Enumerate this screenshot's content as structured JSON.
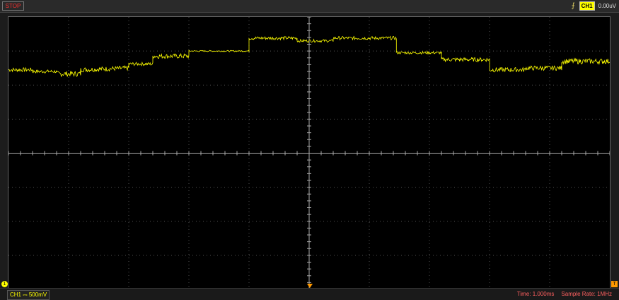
{
  "toolbar": {
    "stop_label": "STOP",
    "trigger_source": "CH1",
    "trigger_level": "0.00uV"
  },
  "markers": {
    "channel_marker": "1",
    "trigger_marker": "T"
  },
  "status": {
    "channel_scale": "CH1 ⎓ 500mV",
    "time": "Time: 1.000ms",
    "sample_rate": "Sample Rate: 1MHz"
  },
  "colors": {
    "trace": "#ffff00",
    "grid": "#3a3a3a",
    "stop": "#ff3030"
  },
  "chart_data": {
    "type": "line",
    "series": [
      {
        "segments": [
          {
            "x": [
              0.0,
              0.04
            ],
            "y": [
              2.45,
              2.45
            ],
            "noise": 0.06
          },
          {
            "x": [
              0.04,
              0.08
            ],
            "y": [
              2.4,
              2.4
            ],
            "noise": 0.05
          },
          {
            "x": [
              0.08,
              0.12
            ],
            "y": [
              2.33,
              2.33
            ],
            "noise": 0.08
          },
          {
            "x": [
              0.12,
              0.2
            ],
            "y": [
              2.45,
              2.5
            ],
            "noise": 0.07
          },
          {
            "x": [
              0.2,
              0.24
            ],
            "y": [
              2.62,
              2.62
            ],
            "noise": 0.05
          },
          {
            "x": [
              0.24,
              0.3
            ],
            "y": [
              2.85,
              2.85
            ],
            "noise": 0.07
          },
          {
            "x": [
              0.3,
              0.4
            ],
            "y": [
              3.0,
              3.0
            ],
            "noise": 0.02
          },
          {
            "x": [
              0.4,
              0.48
            ],
            "y": [
              3.38,
              3.38
            ],
            "noise": 0.05
          },
          {
            "x": [
              0.48,
              0.54
            ],
            "y": [
              3.3,
              3.3
            ],
            "noise": 0.04
          },
          {
            "x": [
              0.54,
              0.645
            ],
            "y": [
              3.38,
              3.38
            ],
            "noise": 0.05
          },
          {
            "x": [
              0.645,
              0.72
            ],
            "y": [
              2.95,
              2.95
            ],
            "noise": 0.04
          },
          {
            "x": [
              0.72,
              0.8
            ],
            "y": [
              2.75,
              2.75
            ],
            "noise": 0.06
          },
          {
            "x": [
              0.8,
              0.86
            ],
            "y": [
              2.45,
              2.45
            ],
            "noise": 0.07
          },
          {
            "x": [
              0.86,
              0.92
            ],
            "y": [
              2.5,
              2.5
            ],
            "noise": 0.07
          },
          {
            "x": [
              0.92,
              1.0
            ],
            "y": [
              2.7,
              2.7
            ],
            "noise": 0.08
          }
        ]
      }
    ],
    "xlim": [
      0,
      1
    ],
    "ylim": [
      -4,
      4
    ],
    "grid": true
  }
}
